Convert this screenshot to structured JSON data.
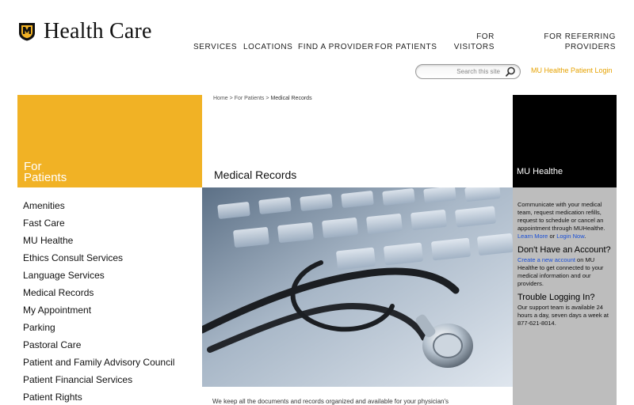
{
  "brand": {
    "name": "Health Care",
    "colors": {
      "gold": "#f1b225",
      "black": "#000000",
      "link": "#1a4fd6"
    }
  },
  "nav": {
    "items": [
      {
        "label": "SERVICES"
      },
      {
        "label": "LOCATIONS"
      },
      {
        "label": "FIND A PROVIDER"
      },
      {
        "label": "FOR PATIENTS"
      }
    ],
    "visitors": {
      "line1": "FOR",
      "line2": "VISITORS"
    },
    "referring": {
      "line1": "FOR REFERRING",
      "line2": "PROVIDERS"
    }
  },
  "search": {
    "placeholder": "Search this site",
    "icon": "search-icon"
  },
  "login_link": "MU Healthe Patient Login",
  "left": {
    "title_line1": "For",
    "title_line2": "Patients",
    "menu": [
      "Amenities",
      "Fast Care",
      "MU Healthe",
      "Ethics Consult Services",
      "Language Services",
      "Medical Records",
      "My Appointment",
      "Parking",
      "Pastoral Care",
      "Patient and Family Advisory Council",
      "Patient Financial Services",
      "Patient Rights"
    ]
  },
  "breadcrumb": {
    "home": "Home",
    "parent": "For Patients",
    "current": "Medical Records",
    "separator": ">"
  },
  "main": {
    "title": "Medical Records",
    "intro": "We keep all the documents and records organized and available for your physician's"
  },
  "right": {
    "title": "MU Healthe",
    "description": "Communicate with your medical team, request medication refills, request to schedule or cancel an appointment through MUHealthe.",
    "learn_more": "Learn More",
    "or": " or ",
    "login_now": "Login Now",
    "period": ".",
    "no_account_heading": "Don't Have an Account?",
    "create_link": "Create a new account",
    "create_text": " on MU Healthe to get connected to your medical information and our providers.",
    "trouble_heading": "Trouble Logging In?",
    "trouble_text": "Our support team is available 24 hours a day, seven days a week at 877-621-8014."
  }
}
